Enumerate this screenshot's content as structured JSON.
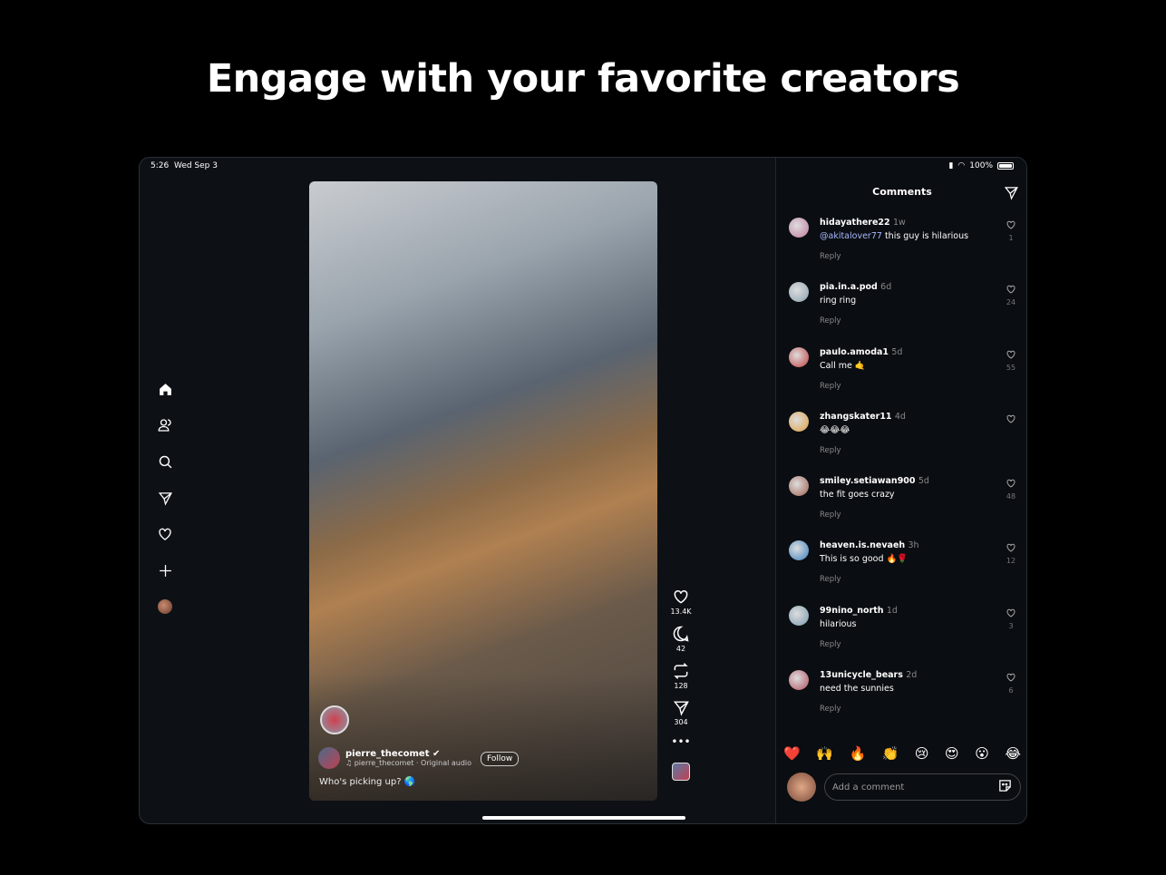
{
  "headline": "Engage with your favorite creators",
  "status": {
    "time": "5:26",
    "date": "Wed Sep 3",
    "battery": "100%"
  },
  "video": {
    "creator": "pierre_thecomet",
    "audio": "pierre_thecomet · Original audio",
    "caption": "Who's picking up? 🌎",
    "follow": "Follow",
    "likes": "13.4K",
    "comments": "42",
    "reposts": "128",
    "shares": "304"
  },
  "comments_panel": {
    "title": "Comments",
    "reply_label": "Reply",
    "placeholder": "Add a comment",
    "items": [
      {
        "user": "hidayathere22",
        "time": "1w",
        "mention": "@akitalover77",
        "text": " this guy is hilarious",
        "likes": "1",
        "color": "#c07aa0"
      },
      {
        "user": "pia.in.a.pod",
        "time": "6d",
        "mention": "",
        "text": "ring ring",
        "likes": "24",
        "color": "#8aa0b0"
      },
      {
        "user": "paulo.amoda1",
        "time": "5d",
        "mention": "",
        "text": "Call me 🤙",
        "likes": "55",
        "color": "#c04040"
      },
      {
        "user": "zhangskater11",
        "time": "4d",
        "mention": "",
        "text": "😂😂😂",
        "likes": "",
        "color": "#e0a040"
      },
      {
        "user": "smiley.setiawan900",
        "time": "5d",
        "mention": "",
        "text": "the fit goes crazy",
        "likes": "48",
        "color": "#a06050"
      },
      {
        "user": "heaven.is.nevaeh",
        "time": "3h",
        "mention": "",
        "text": "This is so good 🔥🌹",
        "likes": "12",
        "color": "#3a80c0"
      },
      {
        "user": "99nino_north",
        "time": "1d",
        "mention": "",
        "text": "hilarious",
        "likes": "3",
        "color": "#7a9ab0"
      },
      {
        "user": "13unicycle_bears",
        "time": "2d",
        "mention": "",
        "text": "need the sunnies",
        "likes": "6",
        "color": "#b05060"
      }
    ],
    "emojis": [
      "❤️",
      "🙌",
      "🔥",
      "👏",
      "😢",
      "😍",
      "😮",
      "😂"
    ]
  }
}
